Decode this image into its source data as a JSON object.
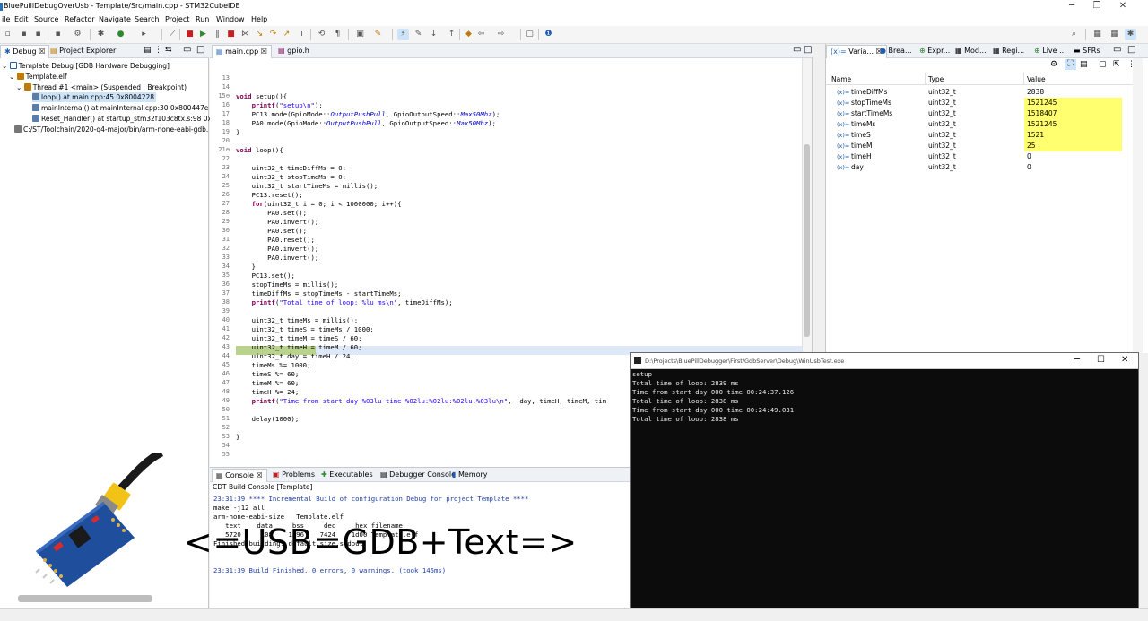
{
  "window": {
    "title": "BluePuillDebugOverUsb - Template/Src/main.cpp - STM32CubeIDE",
    "minimize": "─",
    "maximize": "❐",
    "close": "✕"
  },
  "menu": [
    "ile",
    "Edit",
    "Source",
    "Refactor",
    "Navigate",
    "Search",
    "Project",
    "Run",
    "Window",
    "Help"
  ],
  "debug_panel": {
    "tabs": [
      "Debug",
      "Project Explorer"
    ],
    "tree": [
      {
        "label": "Template Debug [GDB Hardware Debugging]",
        "indent": 0
      },
      {
        "label": "Template.elf",
        "indent": 1
      },
      {
        "label": "Thread #1 <main> (Suspended : Breakpoint)",
        "indent": 2
      },
      {
        "label": "loop() at main.cpp:45 0x8004228",
        "indent": 3,
        "selected": true
      },
      {
        "label": "mainInternal() at mainInternal.cpp:30 0x800447e",
        "indent": 3
      },
      {
        "label": "Reset_Handler() at startup_stm32f103c8tx.s:98 0x800",
        "indent": 3
      },
      {
        "label": "C:/ST/Toolchain/2020-q4-major/bin/arm-none-eabi-gdb.",
        "indent": 1
      }
    ]
  },
  "editor": {
    "tabs": [
      "main.cpp",
      "gpio.h"
    ],
    "current_line": 45,
    "lines": [
      {
        "n": "13",
        "code": ""
      },
      {
        "n": "14",
        "code": ""
      },
      {
        "n": "15⊖",
        "code": "void setup(){"
      },
      {
        "n": "16",
        "code": "    printf(\"setup\\n\");"
      },
      {
        "n": "17",
        "code": "    PC13.mode(GpioMode::OutputPushPull, GpioOutputSpeed::Max50Mhz);"
      },
      {
        "n": "18",
        "code": "    PA0.mode(GpioMode::OutputPushPull, GpioOutputSpeed::Max50Mhz);"
      },
      {
        "n": "19",
        "code": "}"
      },
      {
        "n": "20",
        "code": ""
      },
      {
        "n": "21⊖",
        "code": "void loop(){"
      },
      {
        "n": "22",
        "code": ""
      },
      {
        "n": "23",
        "code": "    uint32_t timeDiffMs = 0;"
      },
      {
        "n": "24",
        "code": "    uint32_t stopTimeMs = 0;"
      },
      {
        "n": "25",
        "code": "    uint32_t startTimeMs = millis();"
      },
      {
        "n": "26",
        "code": "    PC13.reset();"
      },
      {
        "n": "27",
        "code": "    for(uint32_t i = 0; i < 1000000; i++){"
      },
      {
        "n": "28",
        "code": "        PA0.set();"
      },
      {
        "n": "29",
        "code": "        PA0.invert();"
      },
      {
        "n": "30",
        "code": "        PA0.set();"
      },
      {
        "n": "31",
        "code": "        PA0.reset();"
      },
      {
        "n": "32",
        "code": "        PA0.invert();"
      },
      {
        "n": "33",
        "code": "        PA0.invert();"
      },
      {
        "n": "34",
        "code": "    }"
      },
      {
        "n": "35",
        "code": "    PC13.set();"
      },
      {
        "n": "36",
        "code": "    stopTimeMs = millis();"
      },
      {
        "n": "37",
        "code": "    timeDiffMs = stopTimeMs - startTimeMs;"
      },
      {
        "n": "38",
        "code": "    printf(\"Total time of loop: %lu ms\\n\", timeDiffMs);"
      },
      {
        "n": "39",
        "code": ""
      },
      {
        "n": "40",
        "code": "    uint32_t timeMs = millis();"
      },
      {
        "n": "41",
        "code": "    uint32_t timeS = timeMs / 1000;"
      },
      {
        "n": "42",
        "code": "    uint32_t timeM = timeS / 60;"
      },
      {
        "n": "43",
        "code": "    uint32_t timeH = timeM / 60;"
      },
      {
        "n": "44",
        "code": "    uint32_t day = timeH / 24;"
      },
      {
        "n": "45",
        "code": "    timeMs %= 1000;"
      },
      {
        "n": "46",
        "code": "    timeS %= 60;"
      },
      {
        "n": "47",
        "code": "    timeM %= 60;"
      },
      {
        "n": "48",
        "code": "    timeH %= 24;"
      },
      {
        "n": "49",
        "code": "    printf(\"Time from start day %03lu time %02lu:%02lu:%02lu.%03lu\\n\",  day, timeH, timeM, tim"
      },
      {
        "n": "50",
        "code": ""
      },
      {
        "n": "51",
        "code": "    delay(1000);"
      },
      {
        "n": "52",
        "code": ""
      },
      {
        "n": "53",
        "code": "}"
      },
      {
        "n": "54",
        "code": ""
      },
      {
        "n": "55",
        "code": ""
      }
    ]
  },
  "variables": {
    "tabs": [
      "Varia...",
      "Brea...",
      "Expr...",
      "Mod...",
      "Regi...",
      "Live ...",
      "SFRs"
    ],
    "columns": [
      "Name",
      "Type",
      "Value"
    ],
    "rows": [
      {
        "name": "timeDiffMs",
        "type": "uint32_t",
        "value": "2838",
        "changed": false
      },
      {
        "name": "stopTimeMs",
        "type": "uint32_t",
        "value": "1521245",
        "changed": true
      },
      {
        "name": "startTimeMs",
        "type": "uint32_t",
        "value": "1518407",
        "changed": true
      },
      {
        "name": "timeMs",
        "type": "uint32_t",
        "value": "1521245",
        "changed": true
      },
      {
        "name": "timeS",
        "type": "uint32_t",
        "value": "1521",
        "changed": true
      },
      {
        "name": "timeM",
        "type": "uint32_t",
        "value": "25",
        "changed": true
      },
      {
        "name": "timeH",
        "type": "uint32_t",
        "value": "0",
        "changed": false
      },
      {
        "name": "day",
        "type": "uint32_t",
        "value": "0",
        "changed": false
      }
    ],
    "var_prefix": "(x)="
  },
  "console": {
    "tabs": [
      "Console",
      "Problems",
      "Executables",
      "Debugger Console",
      "Memory"
    ],
    "header": "CDT Build Console [Template]",
    "lines": [
      "23:31:39 **** Incremental Build of configuration Debug for project Template ****",
      "make -j12 all",
      "arm-none-eabi-size   Template.elf",
      "   text    data     bss     dec     hex filename",
      "   5720     108    1596    7424    1d00 Template.elf",
      "Finished building: default.size.stdout",
      "",
      "23:31:39 Build Finished. 0 errors, 0 warnings. (took 145ms)"
    ]
  },
  "terminal": {
    "title": "D:\\Projects\\BluePillDebugger\\First\\GdbServer\\Debug\\WinUsbTest.exe",
    "lines": [
      "setup",
      "Total time of loop: 2839 ms",
      "Time from start day 000 time 00:24:37.126",
      "Total time of loop: 2838 ms",
      "Time from start day 000 time 00:24:49.031",
      "Total time of loop: 2838 ms"
    ]
  },
  "overlay_text": "<=USB=GDB+Text=>"
}
